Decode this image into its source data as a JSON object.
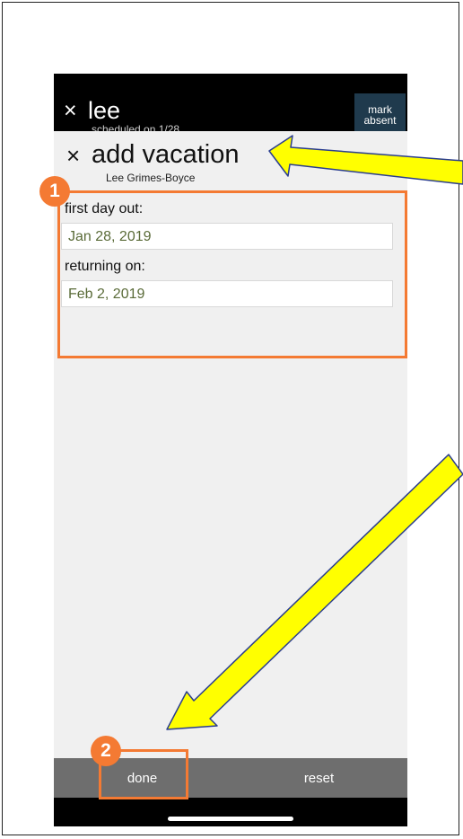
{
  "lee_panel": {
    "close_glyph": "×",
    "name": "lee",
    "schedule_note": "scheduled on 1/28"
  },
  "mark_absent": {
    "label_line1": "mark",
    "label_line2": "absent"
  },
  "vacation": {
    "close_glyph": "×",
    "title": "add vacation",
    "person": "Lee Grimes-Boyce"
  },
  "form": {
    "first_day_label": "first day out:",
    "first_day_value": "Jan 28, 2019",
    "return_label": "returning on:",
    "return_value": "Feb 2, 2019"
  },
  "bottom": {
    "done": "done",
    "reset": "reset"
  },
  "annotations": {
    "badge1": "1",
    "badge2": "2"
  },
  "colors": {
    "highlight": "#f47a33",
    "arrow_fill": "#ffff00",
    "field_text": "#5a6b38",
    "mark_btn": "#1f3a4d"
  },
  "icons": [
    "close-icon",
    "home-indicator"
  ]
}
